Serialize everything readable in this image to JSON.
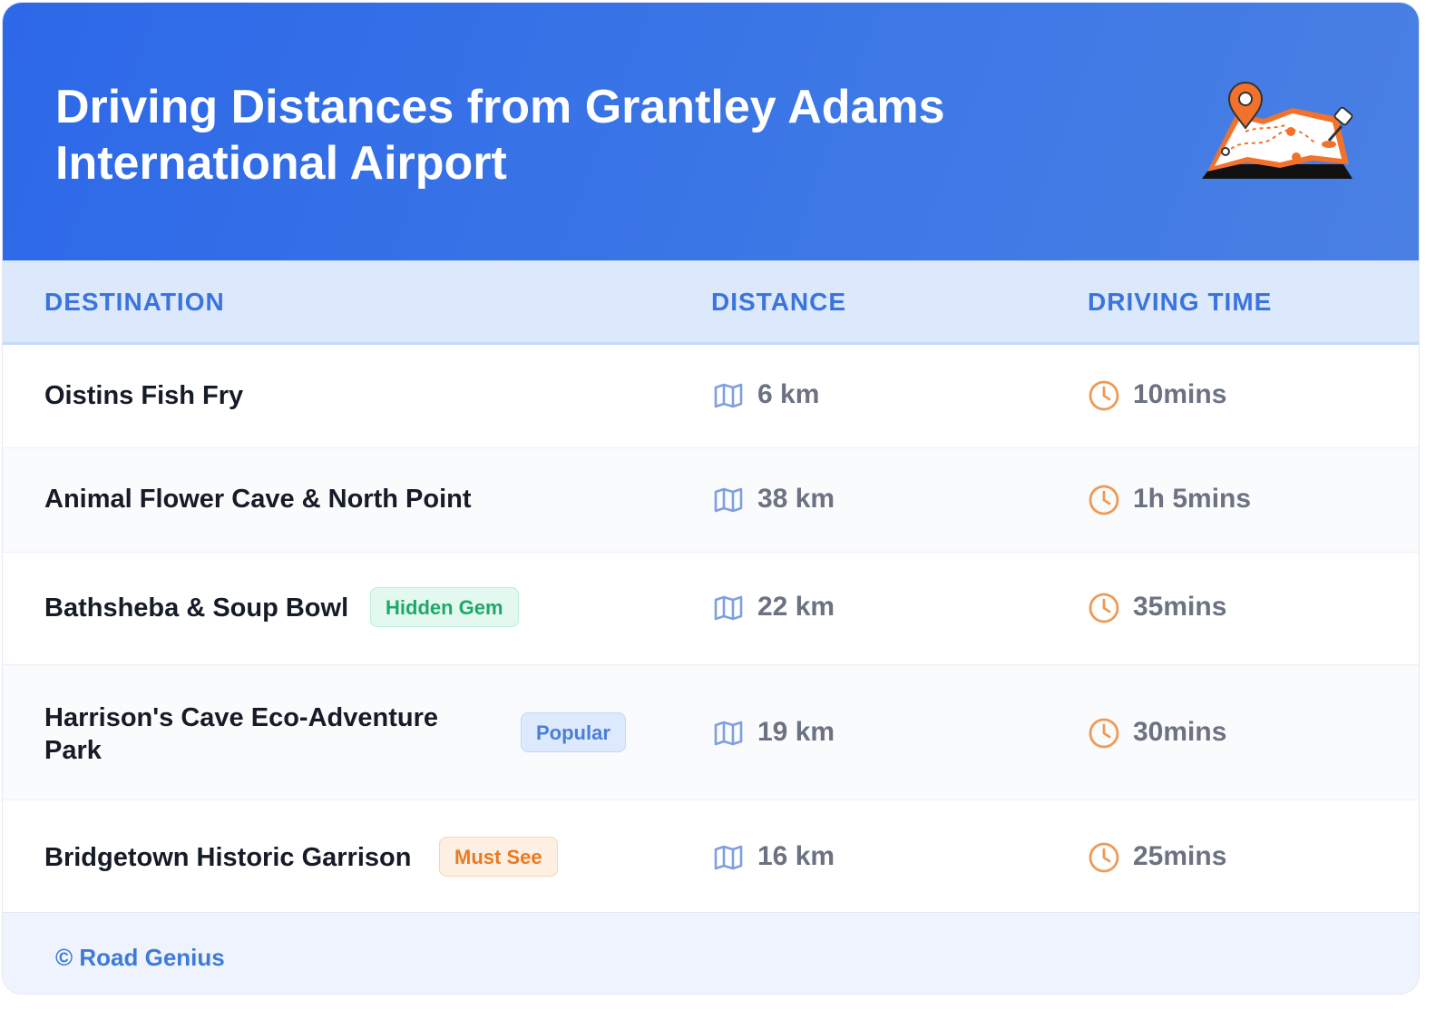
{
  "header": {
    "title_line1": "Driving Distances from Grantley Adams",
    "title_line2": "International Airport",
    "illustration_icon": "map-with-pins-icon"
  },
  "table": {
    "columns": [
      "DESTINATION",
      "DISTANCE",
      "DRIVING TIME"
    ],
    "rows": [
      {
        "destination": "Oistins Fish Fry",
        "badge": "",
        "distance": "6 km",
        "time": "10mins"
      },
      {
        "destination": "Animal Flower Cave & North Point",
        "badge": "",
        "distance": "38 km",
        "time": "1h 5mins"
      },
      {
        "destination": "Bathsheba & Soup Bowl",
        "badge": "Hidden Gem",
        "distance": "22 km",
        "time": "35mins"
      },
      {
        "destination_line1": "Harrison's Cave Eco-Adventure",
        "destination_line2": "Park",
        "badge": "Popular",
        "distance": "19 km",
        "time": "30mins"
      },
      {
        "destination": "Bridgetown Historic Garrison",
        "badge": "Must See",
        "distance": "16 km",
        "time": "25mins"
      }
    ]
  },
  "icons": {
    "distance": "map-icon",
    "time": "clock-icon"
  },
  "colors": {
    "header_blue": "#2d68e8",
    "accent_orange": "#ea7a21",
    "badge_green": "#1ea86a",
    "badge_blue": "#4a7ed9"
  },
  "footer": {
    "text": "© Road Genius"
  }
}
